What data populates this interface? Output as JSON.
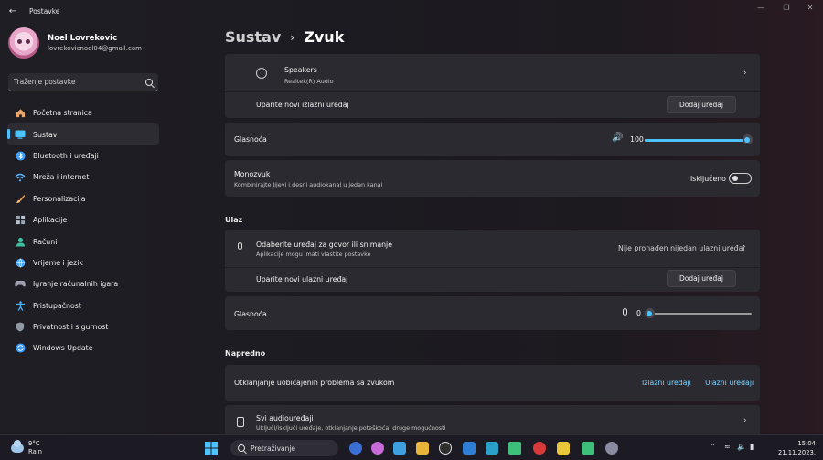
{
  "app": {
    "title": "Postavke"
  },
  "profile": {
    "name": "Noel Lovrekovic",
    "email": "lovrekovicnoel04@gmail.com"
  },
  "search": {
    "placeholder": "Traženje postavke"
  },
  "nav": [
    {
      "label": "Početna stranica",
      "icon": "home-icon",
      "color": "#e8a56a"
    },
    {
      "label": "Sustav",
      "icon": "system-icon",
      "color": "#4cc2ff"
    },
    {
      "label": "Bluetooth i uređaji",
      "icon": "bluetooth-icon",
      "color": "#3aa0ff"
    },
    {
      "label": "Mreža i internet",
      "icon": "wifi-icon",
      "color": "#5ab4ff"
    },
    {
      "label": "Personalizacija",
      "icon": "brush-icon",
      "color": "#f0a050"
    },
    {
      "label": "Aplikacije",
      "icon": "apps-icon",
      "color": "#9aa6b4"
    },
    {
      "label": "Računi",
      "icon": "account-icon",
      "color": "#3fc0a0"
    },
    {
      "label": "Vrijeme i jezik",
      "icon": "globe-icon",
      "color": "#4aa8ff"
    },
    {
      "label": "Igranje računalnih igara",
      "icon": "gamepad-icon",
      "color": "#a0a0b0"
    },
    {
      "label": "Pristupačnost",
      "icon": "accessibility-icon",
      "color": "#4cb4ff"
    },
    {
      "label": "Privatnost i sigurnost",
      "icon": "shield-icon",
      "color": "#9098a4"
    },
    {
      "label": "Windows Update",
      "icon": "update-icon",
      "color": "#3a9cff"
    }
  ],
  "breadcrumb": {
    "parent": "Sustav",
    "current": "Zvuk"
  },
  "output": {
    "device_name": "Speakers",
    "device_sub": "Realtek(R) Audio",
    "pair_label": "Uparite novi izlazni uređaj",
    "add_label": "Dodaj uređaj",
    "volume_label": "Glasnoća",
    "volume_value": "100",
    "volume_level": 100,
    "mono_label": "Monozvuk",
    "mono_sub": "Kombinirajte lijevi i desni audiokanal u jedan kanal",
    "mono_state": "Isključeno"
  },
  "input": {
    "section": "Ulaz",
    "choose_label": "Odaberite uređaj za govor ili snimanje",
    "choose_sub": "Aplikacije mogu imati vlastite postavke",
    "status": "Nije pronađen nijedan ulazni uređaj",
    "pair_label": "Uparite novi ulazni uređaj",
    "add_label": "Dodaj uređaj",
    "volume_label": "Glasnoća",
    "volume_value": "0",
    "volume_level": 0
  },
  "advanced": {
    "section": "Napredno",
    "troubleshoot_label": "Otklanjanje uobičajenih problema sa zvukom",
    "output_link": "Izlazni uređaji",
    "input_link": "Ulazni uređaji",
    "all_label": "Svi audiouređaji",
    "all_sub": "Uključi/isključi uređaje, otklanjanje poteškoća, druge mogućnosti"
  },
  "taskbar": {
    "temp": "9°C",
    "weather": "Rain",
    "search": "Pretraživanje",
    "time": "15:04",
    "date": "21.11.2023."
  }
}
